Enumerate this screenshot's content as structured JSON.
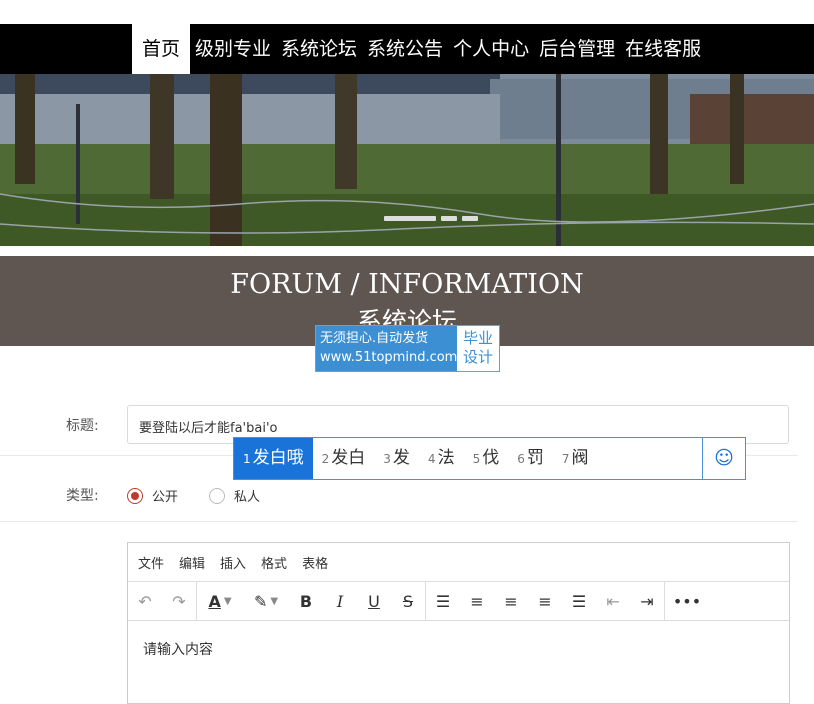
{
  "nav": {
    "items": [
      "首页",
      "级别专业",
      "系统论坛",
      "系统公告",
      "个人中心",
      "后台管理",
      "在线客服"
    ]
  },
  "section": {
    "title_en": "FORUM / INFORMATION",
    "title_cn": "系统论坛"
  },
  "watermark": {
    "line1": "无须担心.自动发货",
    "line2": "www.51topmind.com",
    "side1": "毕业",
    "side2": "设计"
  },
  "form": {
    "title_label": "标题:",
    "title_value": "要登陆以后才能fa'bai'o",
    "type_label": "类型:",
    "type_options": [
      "公开",
      "私人"
    ],
    "type_selected": "公开"
  },
  "ime": {
    "candidates": [
      {
        "n": "1",
        "text": "发白哦"
      },
      {
        "n": "2",
        "text": "发白"
      },
      {
        "n": "3",
        "text": "发"
      },
      {
        "n": "4",
        "text": "法"
      },
      {
        "n": "5",
        "text": "伐"
      },
      {
        "n": "6",
        "text": "罚"
      },
      {
        "n": "7",
        "text": "阀"
      }
    ],
    "emoji": "☺"
  },
  "editor": {
    "menus": [
      "文件",
      "编辑",
      "插入",
      "格式",
      "表格"
    ],
    "placeholder": "请输入内容",
    "icons": [
      "undo-icon",
      "redo-icon",
      "text-color-icon",
      "highlight-icon",
      "bold-icon",
      "italic-icon",
      "underline-icon",
      "strikethrough-icon",
      "line-height-icon",
      "align-left-icon",
      "align-center-icon",
      "align-right-icon",
      "justify-icon",
      "outdent-icon",
      "indent-icon",
      "more-icon"
    ]
  },
  "colors": {
    "accent": "#1a73d9",
    "radio": "#c0392b",
    "section_bg": "#5f5551",
    "nav_bg": "#000000"
  }
}
